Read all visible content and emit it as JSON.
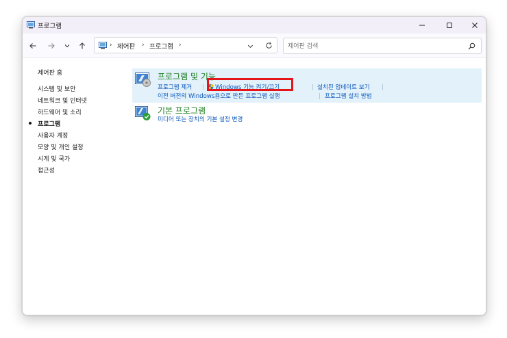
{
  "window": {
    "title": "프로그램"
  },
  "nav": {
    "breadcrumbs": [
      "제어판",
      "프로그램"
    ],
    "search_placeholder": "제어판 검색"
  },
  "sidebar": {
    "home": "제어판 홈",
    "items": [
      {
        "label": "시스템 및 보안",
        "active": false
      },
      {
        "label": "네트워크 및 인터넷",
        "active": false
      },
      {
        "label": "하드웨어 및 소리",
        "active": false
      },
      {
        "label": "프로그램",
        "active": true
      },
      {
        "label": "사용자 계정",
        "active": false
      },
      {
        "label": "모양 및 개인 설정",
        "active": false
      },
      {
        "label": "시계 및 국가",
        "active": false
      },
      {
        "label": "접근성",
        "active": false
      }
    ]
  },
  "sections": [
    {
      "title": "프로그램 및 기능",
      "links": [
        "프로그램 제거",
        "Windows 기능 켜기/끄기",
        "설치된 업데이트 보기",
        "이전 버전의 Windows용으로 만든 프로그램 실행",
        "프로그램 설치 방법"
      ]
    },
    {
      "title": "기본 프로그램",
      "links": [
        "미디어 또는 장치의 기본 설정 변경"
      ]
    }
  ],
  "colors": {
    "section_title": "#1e7d1e",
    "link": "#0a56b8",
    "highlight_bg": "#e3f1fb",
    "annotation_box": "#e4141b",
    "titlebar_bg": "#f3eff9"
  },
  "icons": [
    "control-panel-icon",
    "programs-features-icon",
    "default-programs-icon",
    "search-icon",
    "refresh-icon"
  ]
}
